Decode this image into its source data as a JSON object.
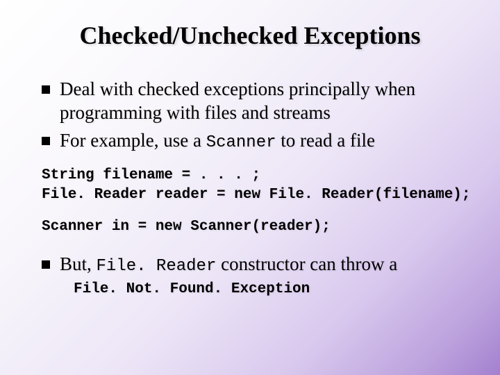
{
  "title": "Checked/Unchecked Exceptions",
  "bullets": {
    "b1": "Deal with checked exceptions principally when programming with files and streams",
    "b2_pre": "For example, use a ",
    "b2_code": "Scanner",
    "b2_post": " to read a file"
  },
  "code": {
    "c1": "String filename = . . . ;\nFile. Reader reader = new File. Reader(filename);",
    "c2": "Scanner in = new Scanner(reader);"
  },
  "last": {
    "pre": "But, ",
    "code": "File. Reader",
    "post": " constructor can throw a",
    "exc": "File. Not. Found. Exception"
  }
}
